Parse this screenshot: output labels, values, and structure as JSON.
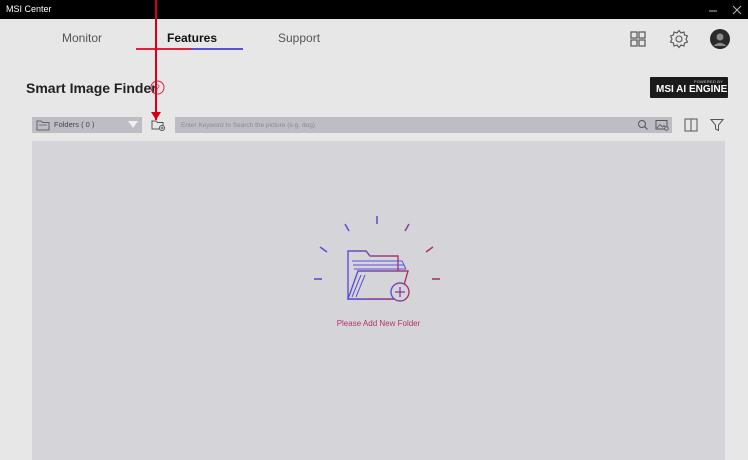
{
  "window": {
    "title": "MSI Center"
  },
  "tabs": [
    {
      "label": "Monitor"
    },
    {
      "label": "Features"
    },
    {
      "label": "Support"
    }
  ],
  "page": {
    "title": "Smart Image Finder"
  },
  "badge": {
    "sub": "POWERED BY",
    "main": "MSI AI ENGINE"
  },
  "toolbar": {
    "folder_select": "Folders ( 0 )",
    "search_placeholder": "Enter Keyword to Search the picture (e.g. dog)"
  },
  "empty_state": {
    "message": "Please Add New Folder"
  },
  "icons": {
    "apps": "grid-icon",
    "settings": "gear-icon",
    "profile": "avatar-icon",
    "help": "help-icon",
    "add_folder": "add-folder-icon",
    "search": "search-icon",
    "image_search": "image-search-icon",
    "layout": "layout-icon",
    "filter": "filter-icon"
  },
  "colors": {
    "accent_red": "#e0213c",
    "accent_blue": "#5a51d6",
    "empty_text": "#b0336a"
  }
}
